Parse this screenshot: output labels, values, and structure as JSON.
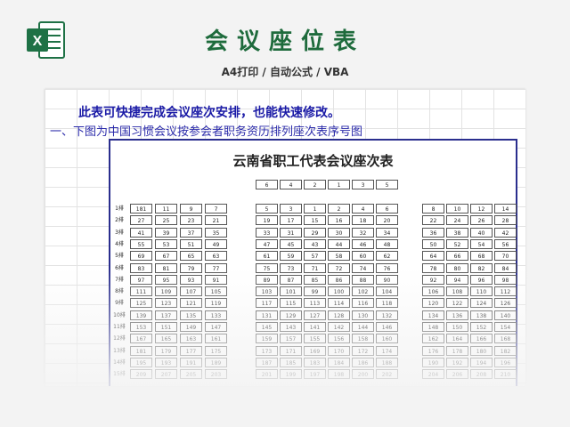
{
  "header": {
    "title": "会议座位表",
    "subtitle": "A4打印 / 自动公式 / VBA",
    "logo_icon": "excel-logo-icon"
  },
  "sheet": {
    "line1": "此表可快捷完成会议座次安排，也能快速修改。",
    "line2": "一、下图为中国习惯会议按参会者职务资历排列座次表序号图",
    "chart_title": "云南省职工代表会议座次表",
    "head_seats": [
      "6",
      "4",
      "2",
      "1",
      "3",
      "5"
    ],
    "rows": [
      {
        "label": "1排",
        "left": [
          "181",
          "11",
          "9",
          "7"
        ],
        "mid": [
          "5",
          "3",
          "1",
          "2",
          "4",
          "6"
        ],
        "right": [
          "8",
          "10",
          "12",
          "14"
        ]
      },
      {
        "label": "2排",
        "left": [
          "27",
          "25",
          "23",
          "21"
        ],
        "mid": [
          "19",
          "17",
          "15",
          "16",
          "18",
          "20"
        ],
        "right": [
          "22",
          "24",
          "26",
          "28"
        ]
      },
      {
        "label": "3排",
        "left": [
          "41",
          "39",
          "37",
          "35"
        ],
        "mid": [
          "33",
          "31",
          "29",
          "30",
          "32",
          "34"
        ],
        "right": [
          "36",
          "38",
          "40",
          "42"
        ]
      },
      {
        "label": "4排",
        "left": [
          "55",
          "53",
          "51",
          "49"
        ],
        "mid": [
          "47",
          "45",
          "43",
          "44",
          "46",
          "48"
        ],
        "right": [
          "50",
          "52",
          "54",
          "56"
        ]
      },
      {
        "label": "5排",
        "left": [
          "69",
          "67",
          "65",
          "63"
        ],
        "mid": [
          "61",
          "59",
          "57",
          "58",
          "60",
          "62"
        ],
        "right": [
          "64",
          "66",
          "68",
          "70"
        ]
      },
      {
        "label": "6排",
        "left": [
          "83",
          "81",
          "79",
          "77"
        ],
        "mid": [
          "75",
          "73",
          "71",
          "72",
          "74",
          "76"
        ],
        "right": [
          "78",
          "80",
          "82",
          "84"
        ]
      },
      {
        "label": "7排",
        "left": [
          "97",
          "95",
          "93",
          "91"
        ],
        "mid": [
          "89",
          "87",
          "85",
          "86",
          "88",
          "90"
        ],
        "right": [
          "92",
          "94",
          "96",
          "98"
        ]
      },
      {
        "label": "8排",
        "left": [
          "111",
          "109",
          "107",
          "105"
        ],
        "mid": [
          "103",
          "101",
          "99",
          "100",
          "102",
          "104"
        ],
        "right": [
          "106",
          "108",
          "110",
          "112"
        ]
      },
      {
        "label": "9排",
        "left": [
          "125",
          "123",
          "121",
          "119"
        ],
        "mid": [
          "117",
          "115",
          "113",
          "114",
          "116",
          "118"
        ],
        "right": [
          "120",
          "122",
          "124",
          "126"
        ]
      },
      {
        "label": "10排",
        "left": [
          "139",
          "137",
          "135",
          "133"
        ],
        "mid": [
          "131",
          "129",
          "127",
          "128",
          "130",
          "132"
        ],
        "right": [
          "134",
          "136",
          "138",
          "140"
        ]
      },
      {
        "label": "11排",
        "left": [
          "153",
          "151",
          "149",
          "147"
        ],
        "mid": [
          "145",
          "143",
          "141",
          "142",
          "144",
          "146"
        ],
        "right": [
          "148",
          "150",
          "152",
          "154"
        ]
      },
      {
        "label": "12排",
        "left": [
          "167",
          "165",
          "163",
          "161"
        ],
        "mid": [
          "159",
          "157",
          "155",
          "156",
          "158",
          "160"
        ],
        "right": [
          "162",
          "164",
          "166",
          "168"
        ]
      },
      {
        "label": "13排",
        "left": [
          "181",
          "179",
          "177",
          "175"
        ],
        "mid": [
          "173",
          "171",
          "169",
          "170",
          "172",
          "174"
        ],
        "right": [
          "176",
          "178",
          "180",
          "182"
        ]
      },
      {
        "label": "14排",
        "left": [
          "195",
          "193",
          "191",
          "189"
        ],
        "mid": [
          "187",
          "185",
          "183",
          "184",
          "186",
          "188"
        ],
        "right": [
          "190",
          "192",
          "194",
          "196"
        ]
      },
      {
        "label": "15排",
        "left": [
          "209",
          "207",
          "205",
          "203"
        ],
        "mid": [
          "201",
          "199",
          "197",
          "198",
          "200",
          "202"
        ],
        "right": [
          "204",
          "206",
          "208",
          "210"
        ]
      }
    ]
  },
  "colors": {
    "title_green": "#1e6b3c",
    "excel_green": "#1e7145",
    "note_blue": "#1a1aa6",
    "frame_blue": "#2a2e8e"
  }
}
